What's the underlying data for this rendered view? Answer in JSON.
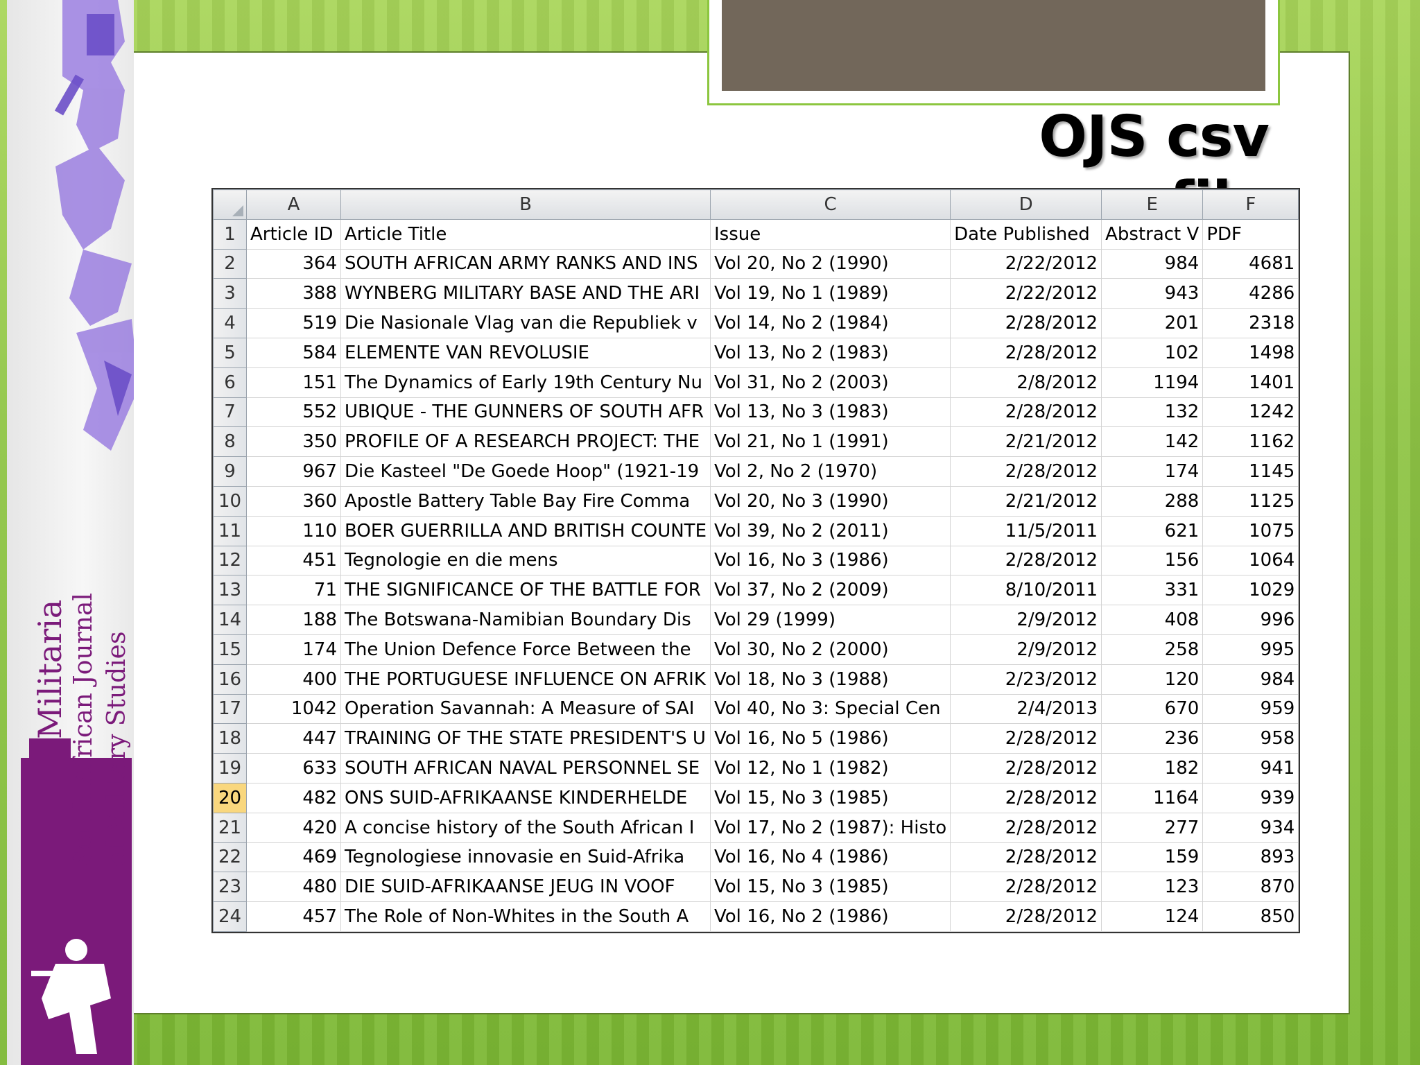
{
  "slide": {
    "title": "OJS csv file"
  },
  "banner": {
    "journal_name": "Scientia Militaria",
    "subtitle_line1": "South African Journal",
    "subtitle_line2": "of Military Studies"
  },
  "sheet": {
    "columns": [
      "A",
      "B",
      "C",
      "D",
      "E",
      "F"
    ],
    "selected_row": "20",
    "rows": [
      {
        "n": "1",
        "a": "Article ID",
        "b": "Article Title",
        "c": "Issue",
        "d": "Date Published",
        "e": "Abstract V",
        "f": "PDF"
      },
      {
        "n": "2",
        "a": "364",
        "b": "SOUTH AFRICAN ARMY RANKS AND INS",
        "c": "Vol 20, No 2 (1990)",
        "d": "2/22/2012",
        "e": "984",
        "f": "4681"
      },
      {
        "n": "3",
        "a": "388",
        "b": "WYNBERG MILITARY BASE AND THE ARI",
        "c": "Vol 19, No 1 (1989)",
        "d": "2/22/2012",
        "e": "943",
        "f": "4286"
      },
      {
        "n": "4",
        "a": "519",
        "b": "Die Nasionale Vlag van die Republiek v",
        "c": "Vol 14, No 2 (1984)",
        "d": "2/28/2012",
        "e": "201",
        "f": "2318"
      },
      {
        "n": "5",
        "a": "584",
        "b": "ELEMENTE VAN REVOLUSIE",
        "c": "Vol 13, No 2 (1983)",
        "d": "2/28/2012",
        "e": "102",
        "f": "1498"
      },
      {
        "n": "6",
        "a": "151",
        "b": "The Dynamics of Early 19th Century Nu",
        "c": "Vol 31, No 2 (2003)",
        "d": "2/8/2012",
        "e": "1194",
        "f": "1401"
      },
      {
        "n": "7",
        "a": "552",
        "b": "UBIQUE - THE GUNNERS OF SOUTH AFR",
        "c": "Vol 13, No 3 (1983)",
        "d": "2/28/2012",
        "e": "132",
        "f": "1242"
      },
      {
        "n": "8",
        "a": "350",
        "b": "PROFILE OF A RESEARCH PROJECT: THE",
        "c": "Vol 21, No 1 (1991)",
        "d": "2/21/2012",
        "e": "142",
        "f": "1162"
      },
      {
        "n": "9",
        "a": "967",
        "b": "Die Kasteel \"De Goede Hoop\" (1921-19",
        "c": "Vol 2, No 2 (1970)",
        "d": "2/28/2012",
        "e": "174",
        "f": "1145"
      },
      {
        "n": "10",
        "a": "360",
        "b": "Apostle Battery Table Bay Fire Comma",
        "c": "Vol 20, No 3 (1990)",
        "d": "2/21/2012",
        "e": "288",
        "f": "1125"
      },
      {
        "n": "11",
        "a": "110",
        "b": "BOER GUERRILLA AND BRITISH COUNTE",
        "c": "Vol 39, No 2 (2011)",
        "d": "11/5/2011",
        "e": "621",
        "f": "1075"
      },
      {
        "n": "12",
        "a": "451",
        "b": "Tegnologie en die mens",
        "c": "Vol 16, No 3 (1986)",
        "d": "2/28/2012",
        "e": "156",
        "f": "1064"
      },
      {
        "n": "13",
        "a": "71",
        "b": "THE SIGNIFICANCE OF THE BATTLE FOR",
        "c": "Vol 37, No 2 (2009)",
        "d": "8/10/2011",
        "e": "331",
        "f": "1029"
      },
      {
        "n": "14",
        "a": "188",
        "b": "The Botswana-Namibian Boundary Dis",
        "c": "Vol 29 (1999)",
        "d": "2/9/2012",
        "e": "408",
        "f": "996"
      },
      {
        "n": "15",
        "a": "174",
        "b": "The Union Defence Force Between the",
        "c": "Vol 30, No 2 (2000)",
        "d": "2/9/2012",
        "e": "258",
        "f": "995"
      },
      {
        "n": "16",
        "a": "400",
        "b": "THE PORTUGUESE INFLUENCE ON AFRIK",
        "c": "Vol 18, No 3 (1988)",
        "d": "2/23/2012",
        "e": "120",
        "f": "984"
      },
      {
        "n": "17",
        "a": "1042",
        "b": "Operation Savannah: A Measure of SAI",
        "c": "Vol 40, No 3: Special Cen",
        "d": "2/4/2013",
        "e": "670",
        "f": "959"
      },
      {
        "n": "18",
        "a": "447",
        "b": "TRAINING OF THE STATE PRESIDENT'S U",
        "c": "Vol 16, No 5 (1986)",
        "d": "2/28/2012",
        "e": "236",
        "f": "958"
      },
      {
        "n": "19",
        "a": "633",
        "b": "SOUTH AFRICAN NAVAL PERSONNEL SE",
        "c": "Vol 12, No 1 (1982)",
        "d": "2/28/2012",
        "e": "182",
        "f": "941"
      },
      {
        "n": "20",
        "a": "482",
        "b": "ONS SUID-AFRIKAANSE KINDERHELDE",
        "c": "Vol 15, No 3 (1985)",
        "d": "2/28/2012",
        "e": "1164",
        "f": "939"
      },
      {
        "n": "21",
        "a": "420",
        "b": "A concise history of the South African I",
        "c": "Vol 17, No 2 (1987): Histo",
        "d": "2/28/2012",
        "e": "277",
        "f": "934"
      },
      {
        "n": "22",
        "a": "469",
        "b": "Tegnologiese innovasie en Suid-Afrika",
        "c": "Vol 16, No 4 (1986)",
        "d": "2/28/2012",
        "e": "159",
        "f": "893"
      },
      {
        "n": "23",
        "a": "480",
        "b": "DIE SUID-AFRIKAANSE JEUG IN      VOOF",
        "c": "Vol 15, No 3 (1985)",
        "d": "2/28/2012",
        "e": "123",
        "f": "870"
      },
      {
        "n": "24",
        "a": "457",
        "b": "The Role of Non-Whites in the South A",
        "c": "Vol 16, No 2 (1986)",
        "d": "2/28/2012",
        "e": "124",
        "f": "850"
      }
    ]
  }
}
